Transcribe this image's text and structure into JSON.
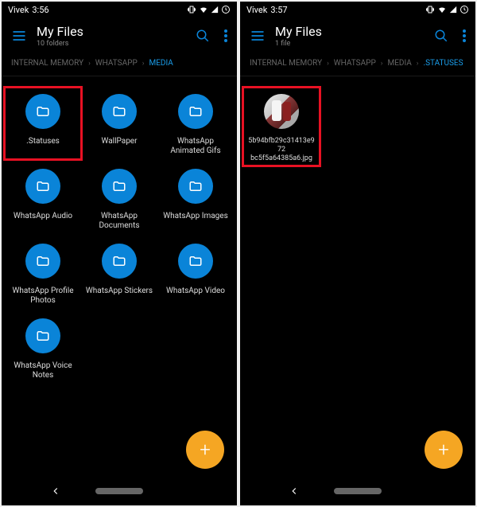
{
  "left": {
    "status": {
      "carrier": "Vivek",
      "time": "3:56"
    },
    "app_title": "My Files",
    "subtitle": "10 folders",
    "breadcrumb": [
      "INTERNAL MEMORY",
      "WHATSAPP",
      "MEDIA"
    ],
    "active_crumb_index": 2,
    "folders": [
      ".Statuses",
      "WallPaper",
      "WhatsApp Animated Gifs",
      "WhatsApp Audio",
      "WhatsApp Documents",
      "WhatsApp Images",
      "WhatsApp Profile Photos",
      "WhatsApp Stickers",
      "WhatsApp Video",
      "WhatsApp Voice Notes"
    ],
    "highlight_index": 0
  },
  "right": {
    "status": {
      "carrier": "Vivek",
      "time": "3:57"
    },
    "app_title": "My Files",
    "subtitle": "1 file",
    "breadcrumb": [
      "INTERNAL MEMORY",
      "WHATSAPP",
      "MEDIA",
      ".STATUSES"
    ],
    "active_crumb_index": 3,
    "files": [
      {
        "name_line1": "5b94bfb29c31413e972",
        "name_line2": "bc5f5a64385a6.jpg"
      }
    ],
    "highlight_index": 0
  },
  "icons": {
    "folder_glyph": "folder",
    "fab_plus": "+"
  }
}
